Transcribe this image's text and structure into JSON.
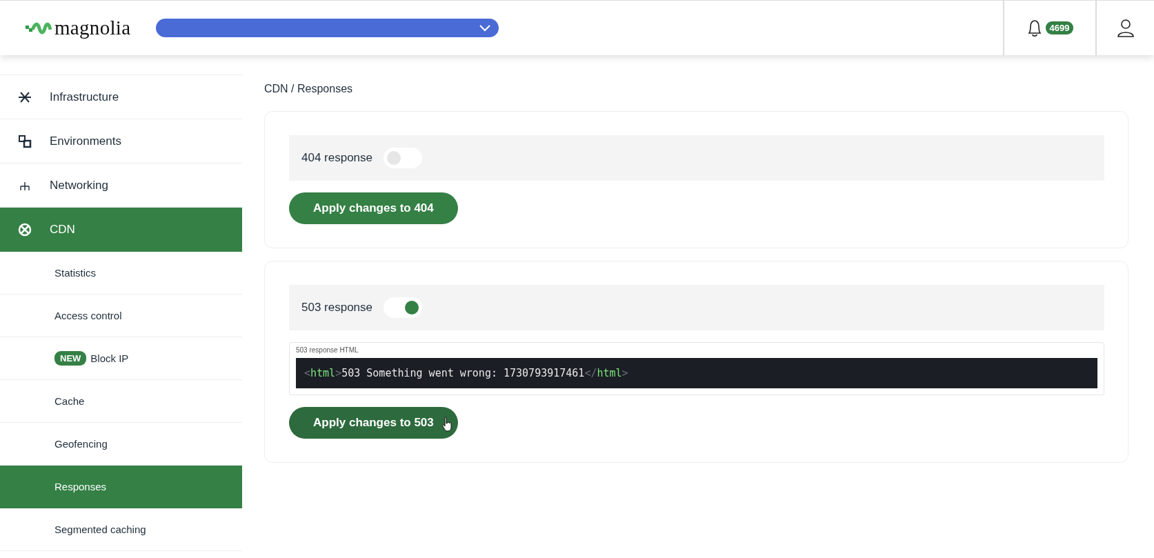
{
  "header": {
    "logo": "magnolia",
    "notifications": {
      "count": "4699"
    }
  },
  "sidebar": {
    "items": [
      {
        "label": "Infrastructure",
        "selected": false
      },
      {
        "label": "Environments",
        "selected": false
      },
      {
        "label": "Networking",
        "selected": false
      },
      {
        "label": "CDN",
        "selected": true,
        "children": [
          {
            "label": "Statistics",
            "selected": false
          },
          {
            "label": "Access control",
            "selected": false
          },
          {
            "label": "Block IP",
            "badge": "NEW",
            "selected": false
          },
          {
            "label": "Cache",
            "selected": false
          },
          {
            "label": "Geofencing",
            "selected": false
          },
          {
            "label": "Responses",
            "selected": true
          },
          {
            "label": "Segmented caching",
            "selected": false
          }
        ]
      }
    ]
  },
  "breadcrumb": "CDN / Responses",
  "responses": [
    {
      "label": "404 response",
      "on": false,
      "button": "Apply changes to 404"
    },
    {
      "label": "503 response",
      "on": true,
      "editor": {
        "label": "503 response HTML",
        "code": [
          {
            "kind": "punct",
            "text": "<"
          },
          {
            "kind": "tag",
            "text": "html"
          },
          {
            "kind": "punct",
            "text": ">"
          },
          {
            "kind": "text",
            "text": "503 Something went wrong: 1730793917461"
          },
          {
            "kind": "punct",
            "text": "</"
          },
          {
            "kind": "tag",
            "text": "html"
          },
          {
            "kind": "punct",
            "text": ">"
          }
        ]
      },
      "button": "Apply changes to 503",
      "hover": true
    }
  ]
}
